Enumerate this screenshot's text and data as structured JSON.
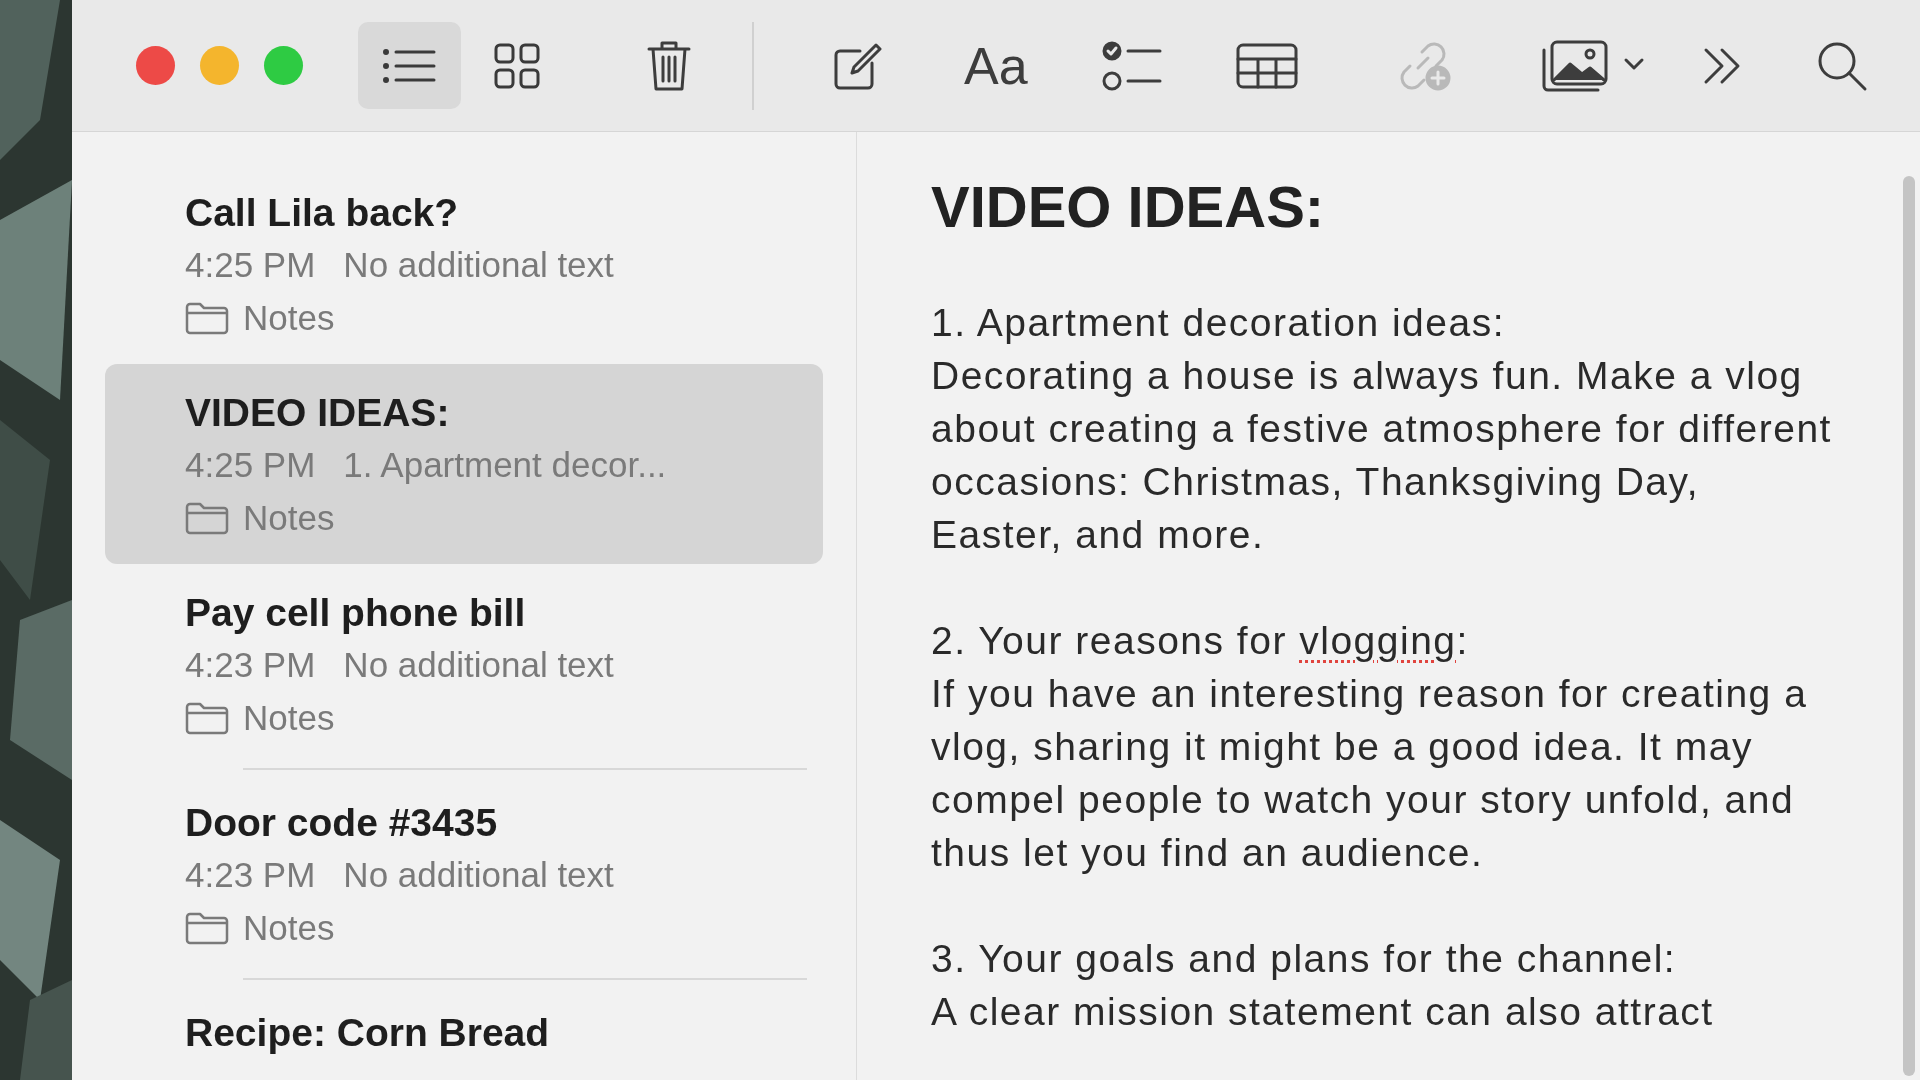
{
  "window": {
    "controls": [
      {
        "kind": "close"
      },
      {
        "kind": "minimize"
      },
      {
        "kind": "zoom"
      }
    ]
  },
  "toolbar": {
    "view_modes": [
      {
        "kind": "list",
        "selected": true
      },
      {
        "kind": "gallery",
        "selected": false
      }
    ],
    "tools": [
      {
        "kind": "delete",
        "disabled": false
      },
      {
        "kind": "compose",
        "disabled": false
      },
      {
        "kind": "format",
        "label": "Aa",
        "disabled": false
      },
      {
        "kind": "checklist",
        "disabled": false
      },
      {
        "kind": "table",
        "disabled": false
      },
      {
        "kind": "collaborate",
        "disabled": true
      },
      {
        "kind": "media",
        "disabled": false
      },
      {
        "kind": "more",
        "disabled": false
      },
      {
        "kind": "search",
        "disabled": false
      }
    ]
  },
  "notes_list": [
    {
      "title": "Call Lila back?",
      "time": "4:25 PM",
      "preview": "No additional text",
      "folder": "Notes",
      "selected": false
    },
    {
      "title": "VIDEO IDEAS:",
      "time": "4:25 PM",
      "preview": "1. Apartment decor...",
      "folder": "Notes",
      "selected": true
    },
    {
      "title": "Pay cell phone bill",
      "time": "4:23 PM",
      "preview": "No additional text",
      "folder": "Notes",
      "selected": false
    },
    {
      "title": "Door code #3435",
      "time": "4:23 PM",
      "preview": "No additional text",
      "folder": "Notes",
      "selected": false
    },
    {
      "title": "Recipe: Corn Bread",
      "selected": false
    }
  ],
  "note": {
    "title": "VIDEO IDEAS:",
    "paragraphs": [
      {
        "heading": [
          {
            "text": "1. Apartment decoration ideas:",
            "misspelled": false
          }
        ],
        "body": "Decorating a house is always fun. Make a vlog about creating a festive atmosphere for different occasions: Christmas, Thanksgiving Day, Easter, and more."
      },
      {
        "heading": [
          {
            "text": "2. Your reasons for ",
            "misspelled": false
          },
          {
            "text": "vlogging",
            "misspelled": true
          },
          {
            "text": ":",
            "misspelled": false
          }
        ],
        "body": "If you have an interesting reason for creating a vlog, sharing it might be a good idea. It may compel people to watch your story unfold, and thus let you find an audience."
      },
      {
        "heading": [
          {
            "text": "3. Your goals and plans for the channel:",
            "misspelled": false
          }
        ],
        "body": "A clear mission statement can also attract"
      }
    ]
  }
}
